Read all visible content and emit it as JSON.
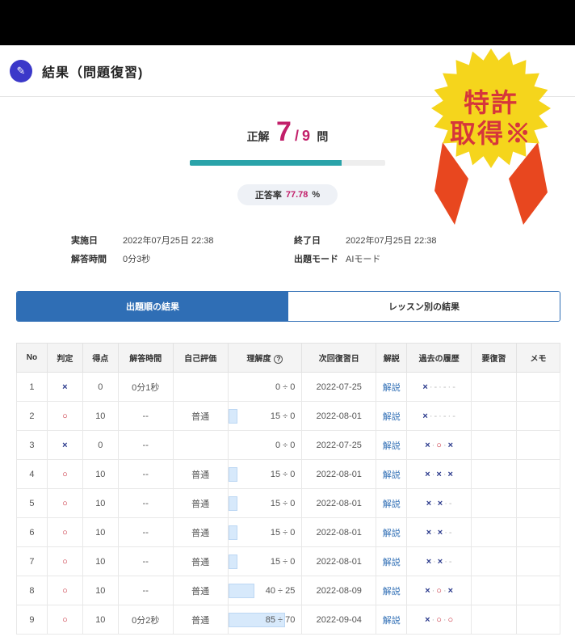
{
  "header": {
    "title": "結果（問題復習)"
  },
  "score": {
    "label": "正解",
    "correct": "7",
    "slash": "/",
    "total": "9",
    "unit": "問",
    "progress": 0.7778
  },
  "rate": {
    "label": "正答率",
    "value": "77.78",
    "unit": "%"
  },
  "meta": {
    "impl_label": "実施日",
    "impl_value": "2022年07月25日 22:38",
    "end_label": "終了日",
    "end_value": "2022年07月25日 22:38",
    "time_label": "解答時間",
    "time_value": "0分3秒",
    "mode_label": "出題モード",
    "mode_value": "AIモード"
  },
  "tabs": [
    "出題順の結果",
    "レッスン別の結果"
  ],
  "columns": [
    "No",
    "判定",
    "得点",
    "解答時間",
    "自己評価",
    "理解度",
    "次回復習日",
    "解説",
    "過去の履歴",
    "要復習",
    "メモ"
  ],
  "rows": [
    {
      "no": "1",
      "judge": "×",
      "score": "0",
      "time": "0分1秒",
      "self": "",
      "und": "0 ÷ 0",
      "und_level": 0,
      "next": "2022-07-25",
      "exp": "解説",
      "hist": [
        "×",
        "-",
        "-",
        "-"
      ]
    },
    {
      "no": "2",
      "judge": "○",
      "score": "10",
      "time": "--",
      "self": "普通",
      "und": "15 ÷ 0",
      "und_level": 0.12,
      "next": "2022-08-01",
      "exp": "解説",
      "hist": [
        "×",
        "-",
        "-",
        "-"
      ]
    },
    {
      "no": "3",
      "judge": "×",
      "score": "0",
      "time": "--",
      "self": "",
      "und": "0 ÷ 0",
      "und_level": 0,
      "next": "2022-07-25",
      "exp": "解説",
      "hist": [
        "×",
        "○",
        "×"
      ]
    },
    {
      "no": "4",
      "judge": "○",
      "score": "10",
      "time": "--",
      "self": "普通",
      "und": "15 ÷ 0",
      "und_level": 0.12,
      "next": "2022-08-01",
      "exp": "解説",
      "hist": [
        "×",
        "×",
        "×"
      ]
    },
    {
      "no": "5",
      "judge": "○",
      "score": "10",
      "time": "--",
      "self": "普通",
      "und": "15 ÷ 0",
      "und_level": 0.12,
      "next": "2022-08-01",
      "exp": "解説",
      "hist": [
        "×",
        "×",
        "-"
      ]
    },
    {
      "no": "6",
      "judge": "○",
      "score": "10",
      "time": "--",
      "self": "普通",
      "und": "15 ÷ 0",
      "und_level": 0.12,
      "next": "2022-08-01",
      "exp": "解説",
      "hist": [
        "×",
        "×",
        "-"
      ]
    },
    {
      "no": "7",
      "judge": "○",
      "score": "10",
      "time": "--",
      "self": "普通",
      "und": "15 ÷ 0",
      "und_level": 0.12,
      "next": "2022-08-01",
      "exp": "解説",
      "hist": [
        "×",
        "×",
        "-"
      ]
    },
    {
      "no": "8",
      "judge": "○",
      "score": "10",
      "time": "--",
      "self": "普通",
      "und": "40 ÷ 25",
      "und_level": 0.36,
      "next": "2022-08-09",
      "exp": "解説",
      "hist": [
        "×",
        "○",
        "×"
      ]
    },
    {
      "no": "9",
      "judge": "○",
      "score": "10",
      "time": "0分2秒",
      "self": "普通",
      "und": "85 ÷ 70",
      "und_level": 0.78,
      "next": "2022-09-04",
      "exp": "解説",
      "hist": [
        "×",
        "○",
        "○"
      ]
    }
  ],
  "badge": {
    "line1": "特許",
    "line2": "取得※",
    "color": "#f5d51c"
  },
  "colors": {
    "accent": "#2f6eb5",
    "correct": "#c21f6a",
    "bar": "#2aa3a9"
  }
}
